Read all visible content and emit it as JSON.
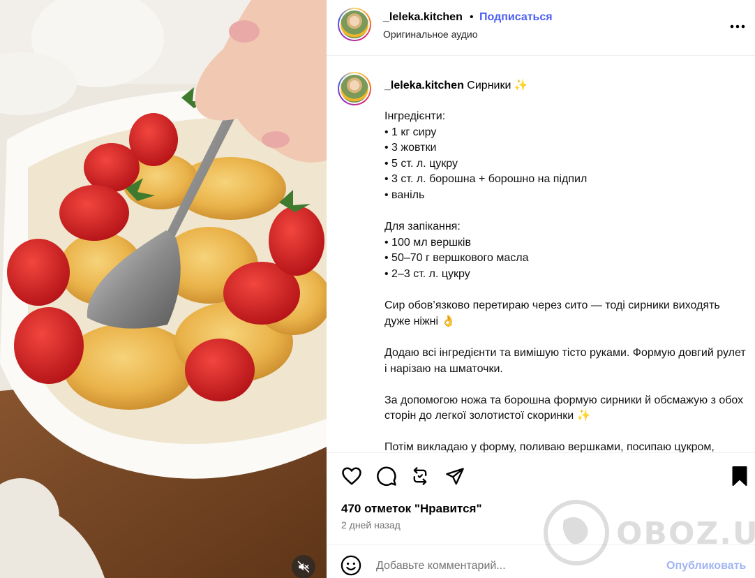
{
  "post": {
    "username": "_leleka.kitchen",
    "separator": "•",
    "follow_label": "Подписаться",
    "audio_label": "Оригинальное аудио",
    "more_icon": "more-horizontal-icon"
  },
  "caption": {
    "username": "_leleka.kitchen",
    "title": "Сирники ✨",
    "text": "Інгредієнти:\n• 1 кг сиру\n• 3 жовтки\n• 5 ст. л. цукру\n• 3 ст. л. борошна + борошно на підпил\n• ваніль\n\nДля запікання:\n• 100 мл вершків\n• 50–70 г вершкового масла\n• 2–3 ст. л. цукру\n\nСир обов’язково перетираю через сито — тоді сирники виходять дуже ніжні 👌\n\nДодаю всі інгредієнти та вимішую тісто руками. Формую довгий рулет і нарізаю на шматочки.\n\nЗа допомогою ножа та борошна формую сирники й обсмажую з обох сторін до легкої золотистої скоринки ✨\n\nПотім викладаю у форму, поливаю вершками, посипаю цукром,"
  },
  "actions": {
    "icons": [
      "heart-icon",
      "comment-icon",
      "repost-icon",
      "share-icon",
      "bookmark-icon"
    ]
  },
  "likes_text": "470 отметок \"Нравится\"",
  "date_text": "2 дней назад",
  "comment": {
    "placeholder": "Добавьте комментарий...",
    "publish_label": "Опубликовать"
  },
  "watermark": "OBOZ.UA",
  "colors": {
    "follow": "#4a5df9",
    "publish_disabled": "#a0b4f5",
    "muted_text": "#737373"
  }
}
